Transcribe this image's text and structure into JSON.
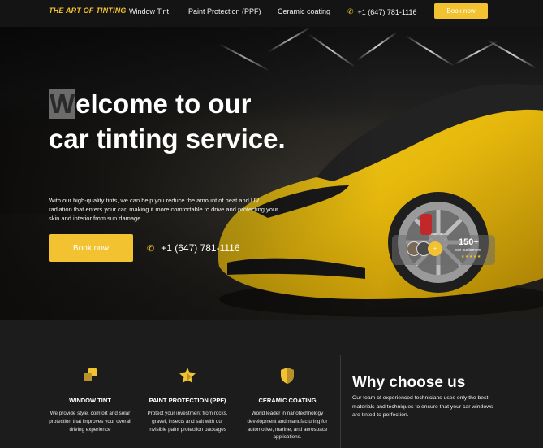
{
  "nav": {
    "logo": "THE ART OF TINTING",
    "links": [
      "Window Tint",
      "Paint Protection (PPF)",
      "Ceramic coating"
    ],
    "phone": "+1 (647) 781-1116",
    "cta": "Book now"
  },
  "hero": {
    "title_first_letter": "W",
    "title_rest": "elcome to our car tinting service.",
    "description": "With our high-quality tints, we can help you reduce the amount of heat and UV radiation that enters your car, making it more comfortable to drive and protecting your skin and interior from sun damage.",
    "cta": "Book now",
    "phone": "+1 (647) 781-1116",
    "badge": {
      "count": "150+",
      "label": "our customers",
      "plus_label": "+",
      "stars": "★★★★★"
    }
  },
  "features": [
    {
      "icon": "window-tint-icon",
      "title": "WINDOW TINT",
      "description": "We provide style, comfort and solar protection that improves your overall driving experience"
    },
    {
      "icon": "star-shield-icon",
      "title": "PAINT PROTECTION (PPF)",
      "description": "Protect your investment from rocks, gravel, insects and salt with our invisible paint protection packages"
    },
    {
      "icon": "shield-icon",
      "title": "CERAMIC COATING",
      "description": "World leader in nanotechnology development and manufacturing for automotive, marine, and aerospace applications."
    }
  ],
  "why": {
    "title": "Why choose us",
    "description": "Our team of experienced technicians uses only the best materials and techniques to ensure that your car windows are tinted to perfection."
  },
  "colors": {
    "accent": "#f2c230",
    "dark": "#1c1c1c"
  }
}
